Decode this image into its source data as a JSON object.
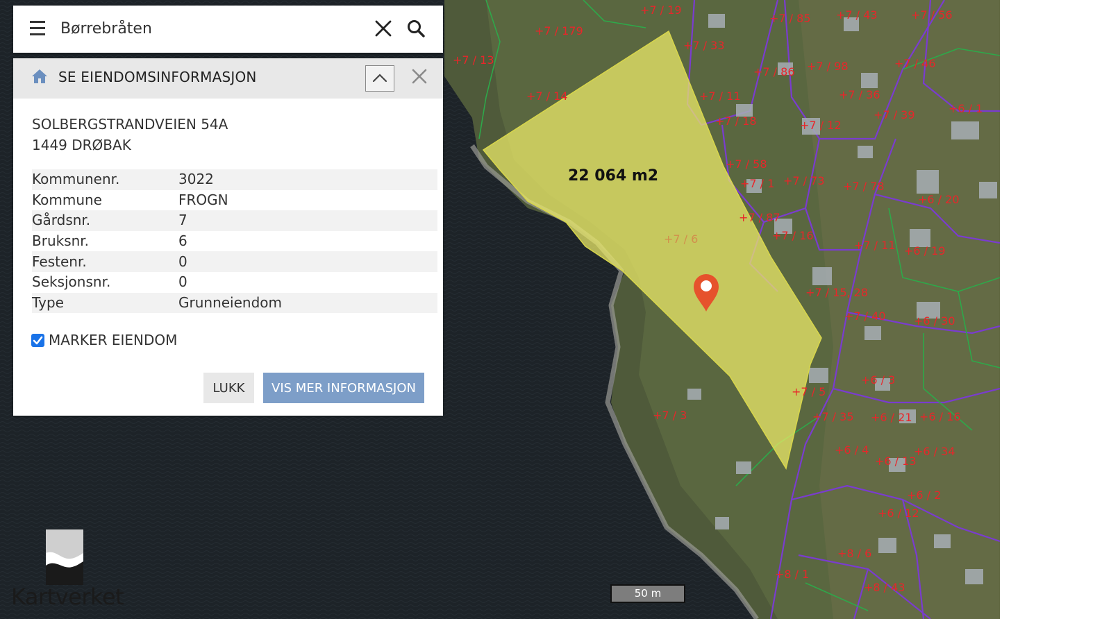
{
  "search": {
    "value": "Børrebråten"
  },
  "panel": {
    "title": "SE EIENDOMSINFORMASJON",
    "address_line1": "SOLBERGSTRANDVEIEN 54A",
    "address_line2": "1449 DRØBAK",
    "properties": [
      {
        "key": "Kommunenr.",
        "value": "3022"
      },
      {
        "key": "Kommune",
        "value": "FROGN"
      },
      {
        "key": "Gårdsnr.",
        "value": "7"
      },
      {
        "key": "Bruksnr.",
        "value": "6"
      },
      {
        "key": "Festenr.",
        "value": "0"
      },
      {
        "key": "Seksjonsnr.",
        "value": "0"
      },
      {
        "key": "Type",
        "value": "Grunneiendom"
      }
    ],
    "marker_label": "MARKER EIENDOM",
    "marker_checked": true,
    "close_label": "LUKK",
    "more_info_label": "VIS MER INFORMASJON"
  },
  "map": {
    "area_label": "22 064 m2",
    "scale_label": "50 m",
    "selected_plot_label": "7 / 6",
    "plot_labels": [
      "7 / 19",
      "7 / 85",
      "7 / 43",
      "7 / 56",
      "7 / 179",
      "7 / 13",
      "7 / 33",
      "7 / 86",
      "7 / 98",
      "7 / 46",
      "7 / 14",
      "7 / 11",
      "7 / 36",
      "7 / 39",
      "6 / 1",
      "7 / 18",
      "7 / 12",
      "7 / 58",
      "7 / 1",
      "7 / 73",
      "7 / 78",
      "6 / 20",
      "7 / 87",
      "7 / 16",
      "7 / 11",
      "6 / 19",
      "7 / 15, 28",
      "7 / 40",
      "6 / 30",
      "6 / 3",
      "7 / 5",
      "7 / 3",
      "7 / 35",
      "6 / 21",
      "6 / 16",
      "6 / 4",
      "6 / 13",
      "6 / 34",
      "6 / 2",
      "6 / 12",
      "8 / 6",
      "8 / 1",
      "8 / 43"
    ],
    "colors": {
      "water": "#1d2328",
      "selection_fill": "#f0ee6a",
      "plot_label": "#e8262a",
      "property_line": "#7a3ccf",
      "boundary_line": "#2ea84a",
      "pin": "#e6522c"
    }
  },
  "logo": {
    "text": "Kartverket"
  }
}
